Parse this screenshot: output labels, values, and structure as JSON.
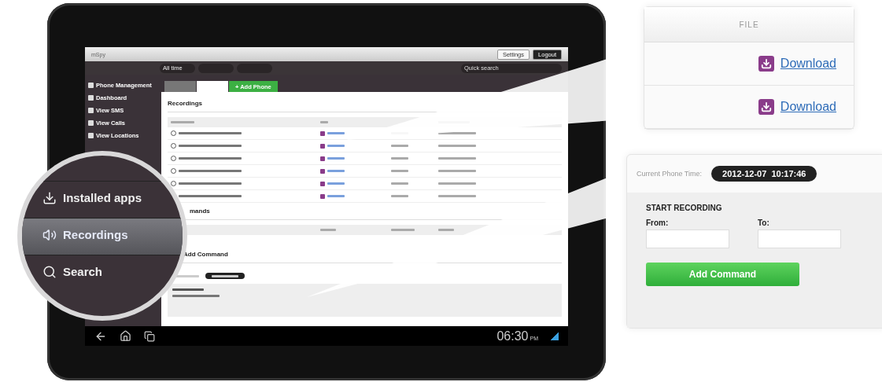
{
  "header": {
    "brand": "mSpy",
    "buttons": [
      "Settings",
      "Logout"
    ]
  },
  "filter_bar": {
    "period": "All time",
    "search_placeholder": "Quick search"
  },
  "sidebar": {
    "items": [
      {
        "label": "Phone Management",
        "selected": false
      },
      {
        "label": "Dashboard",
        "selected": false
      },
      {
        "label": "View SMS",
        "selected": false
      },
      {
        "label": "View Calls",
        "selected": false
      },
      {
        "label": "View Locations",
        "selected": false
      }
    ]
  },
  "tabs": [
    {
      "selected": false
    },
    {
      "selected": true
    },
    {
      "label": "+ Add Phone",
      "selected": false
    }
  ],
  "recordings": {
    "title": "Recordings"
  },
  "commands": {
    "title": "mands"
  },
  "add_command": {
    "title": "Add Command"
  },
  "status_bar": {
    "time": "06:30",
    "ampm": "PM"
  },
  "magnifier": {
    "items": [
      {
        "label": "Installed apps",
        "selected": false
      },
      {
        "label": "Recordings",
        "selected": true
      },
      {
        "label": "Search",
        "selected": false
      }
    ]
  },
  "file_callout": {
    "header": "FILE",
    "links": [
      "Download",
      "Download"
    ]
  },
  "command_callout": {
    "time_label": "Current Phone Time:",
    "time": "2012-12-07  10:17:46",
    "section": "START RECORDING",
    "from": "From:",
    "to": "To:",
    "button": "Add Command"
  }
}
